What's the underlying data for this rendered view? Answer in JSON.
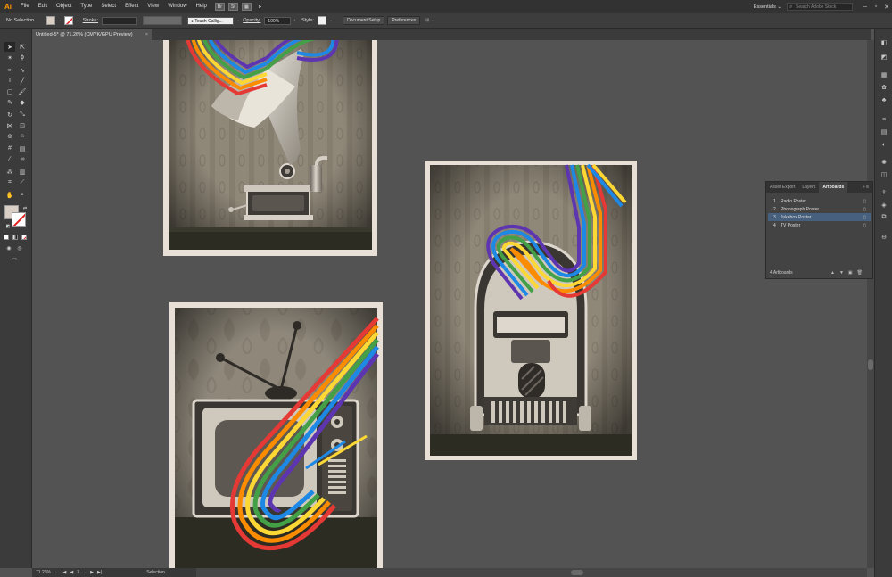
{
  "app": {
    "logo": "Ai"
  },
  "menu": [
    "File",
    "Edit",
    "Object",
    "Type",
    "Select",
    "Effect",
    "View",
    "Window",
    "Help"
  ],
  "bridge": [
    "Br",
    "St"
  ],
  "workspace": "Essentials",
  "search_placeholder": "Search Adobe Stock",
  "window_controls": [
    "–",
    "▫",
    "✕"
  ],
  "control": {
    "selection_status": "No Selection",
    "stroke_label": "Stroke:",
    "brush_value": "Touch Callig...",
    "opacity_label": "Opacity:",
    "opacity_value": "100%",
    "style_label": "Style:",
    "document_setup": "Document Setup",
    "preferences": "Preferences"
  },
  "document_tab": {
    "title": "Untitled-5* @ 71.26% (CMYK/GPU Preview)",
    "close": "×"
  },
  "status": {
    "zoom": "71.26%",
    "page": "3",
    "tool": "Selection"
  },
  "artboards_panel": {
    "tabs": [
      "Asset Export",
      "Layers",
      "Artboards"
    ],
    "items": [
      {
        "num": "1",
        "name": "Radio Poster"
      },
      {
        "num": "2",
        "name": "Phonograph Poster"
      },
      {
        "num": "3",
        "name": "Jukebox Poster"
      },
      {
        "num": "4",
        "name": "TV Poster"
      }
    ],
    "footer": "4 Artboards"
  },
  "colors": {
    "fill_swatch": "#d9cfc4",
    "selection_highlight": "#46607e",
    "app_accent": "#ff9a00"
  },
  "icons": [
    "selection-icon",
    "direct-selection-icon",
    "magic-wand-icon",
    "lasso-icon",
    "pen-icon",
    "curvature-icon",
    "type-icon",
    "line-icon",
    "rectangle-icon",
    "paintbrush-icon",
    "shaper-icon",
    "eraser-icon",
    "rotate-icon",
    "scale-icon",
    "width-icon",
    "free-transform-icon",
    "shape-builder-icon",
    "perspective-icon",
    "mesh-icon",
    "gradient-icon",
    "eyedropper-icon",
    "blend-icon",
    "symbol-sprayer-icon",
    "column-graph-icon",
    "artboard-icon",
    "slice-icon",
    "hand-icon",
    "zoom-icon"
  ]
}
